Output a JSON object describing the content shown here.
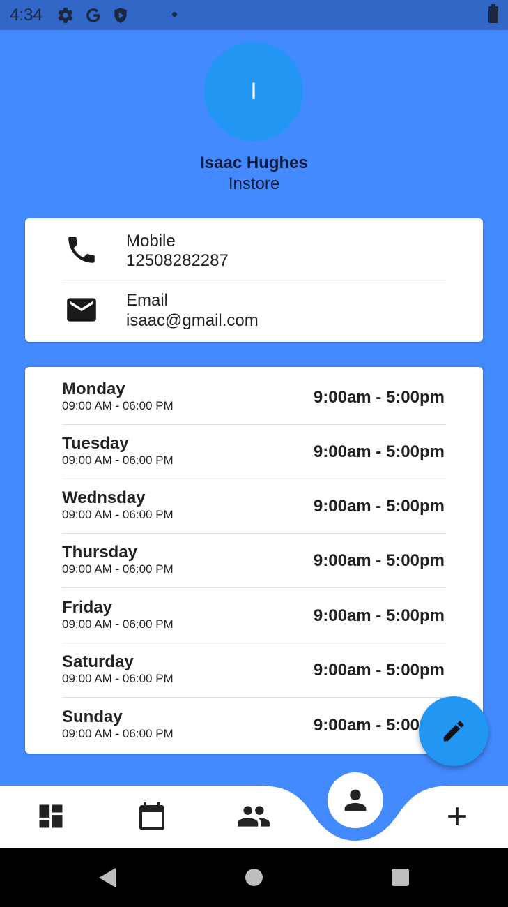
{
  "status_bar": {
    "time": "4:34"
  },
  "profile": {
    "initial": "I",
    "name": "Isaac Hughes",
    "role": "Instore"
  },
  "contact": [
    {
      "label": "Mobile",
      "value": "12508282287",
      "icon": "phone-icon"
    },
    {
      "label": "Email",
      "value": "isaac@gmail.com",
      "icon": "mail-icon"
    }
  ],
  "schedule": [
    {
      "day": "Monday",
      "range": "09:00 AM - 06:00 PM",
      "hours": "9:00am - 5:00pm"
    },
    {
      "day": "Tuesday",
      "range": "09:00 AM - 06:00 PM",
      "hours": "9:00am - 5:00pm"
    },
    {
      "day": "Wednsday",
      "range": "09:00 AM - 06:00 PM",
      "hours": "9:00am - 5:00pm"
    },
    {
      "day": "Thursday",
      "range": "09:00 AM - 06:00 PM",
      "hours": "9:00am - 5:00pm"
    },
    {
      "day": "Friday",
      "range": "09:00 AM - 06:00 PM",
      "hours": "9:00am - 5:00pm"
    },
    {
      "day": "Saturday",
      "range": "09:00 AM - 06:00 PM",
      "hours": "9:00am - 5:00pm"
    },
    {
      "day": "Sunday",
      "range": "09:00 AM - 06:00 PM",
      "hours": "9:00am - 5:00pm"
    }
  ],
  "nav": [
    "dashboard-icon",
    "calendar-icon",
    "people-icon",
    "person-icon",
    "add-icon"
  ],
  "colors": {
    "background": "#448aff",
    "accent": "#2196f3",
    "status_bar": "#3367c7"
  }
}
